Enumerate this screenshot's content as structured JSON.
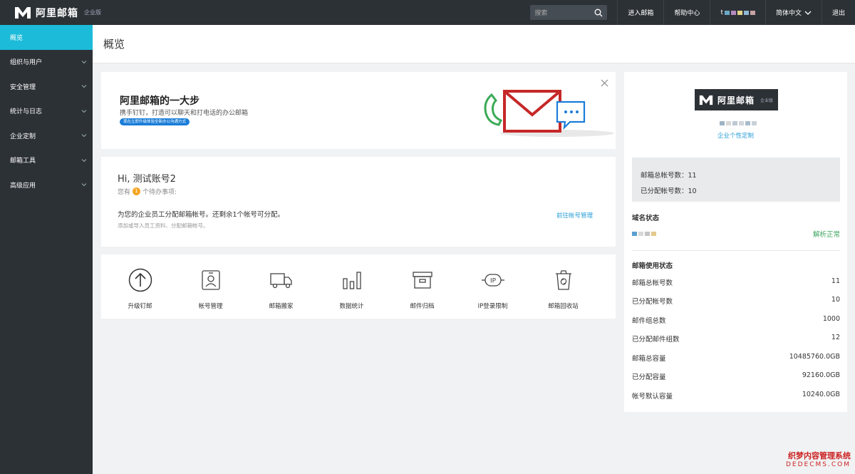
{
  "app": {
    "logo_text": "阿里邮箱",
    "logo_sub": "企业版"
  },
  "topbar": {
    "search_placeholder": "搜索",
    "enter_mailbox": "进入邮箱",
    "help_center": "帮助中心",
    "user_initial": "t",
    "language": "简体中文",
    "logout": "退出"
  },
  "sidebar": {
    "items": [
      {
        "label": "概览"
      },
      {
        "label": "组织与用户"
      },
      {
        "label": "安全管理"
      },
      {
        "label": "统计与日志"
      },
      {
        "label": "企业定制"
      },
      {
        "label": "邮箱工具"
      },
      {
        "label": "高级应用"
      }
    ]
  },
  "page": {
    "title": "概览"
  },
  "banner": {
    "title": "阿里邮箱的一大步",
    "subtitle": "携手钉钉，打造可以聊天和打电话的办公邮箱",
    "pill": "现在立即升级体验全新办公沟通方式"
  },
  "hello": {
    "greeting": "Hi, 测试账号2",
    "todo_prefix": "您有",
    "todo_count": "1",
    "todo_suffix": "个待办事项:",
    "task": "为您的企业员工分配邮箱帐号。还剩余1个帐号可分配。",
    "hint": "添加或导入员工资料、分配邮箱帐号。",
    "link": "前往帐号管理"
  },
  "tools": [
    {
      "label": "升级钉邮",
      "icon": "upgrade-icon"
    },
    {
      "label": "帐号管理",
      "icon": "account-icon"
    },
    {
      "label": "邮箱搬家",
      "icon": "truck-icon"
    },
    {
      "label": "数据统计",
      "icon": "bar-chart-icon"
    },
    {
      "label": "邮件归档",
      "icon": "archive-icon"
    },
    {
      "label": "IP登录限制",
      "icon": "ip-icon"
    },
    {
      "label": "邮箱回收站",
      "icon": "recycle-bin-icon"
    }
  ],
  "right_panel": {
    "customize_link": "企业个性定制",
    "stats": [
      {
        "text": "邮箱总帐号数：11"
      },
      {
        "text": "已分配帐号数：10"
      }
    ],
    "domain_section": "域名状态",
    "domain_status": "解析正常",
    "usage_section": "邮箱使用状态",
    "usage": [
      {
        "label": "邮箱总帐号数",
        "value": "11"
      },
      {
        "label": "已分配帐号数",
        "value": "10"
      },
      {
        "label": "邮件组总数",
        "value": "1000"
      },
      {
        "label": "已分配邮件组数",
        "value": "12"
      },
      {
        "label": "邮箱总容量",
        "value": "10485760.0GB"
      },
      {
        "label": "已分配容量",
        "value": "92160.0GB"
      },
      {
        "label": "帐号默认容量",
        "value": "10240.0GB"
      }
    ]
  },
  "watermark": {
    "cn": "织梦内容管理系统",
    "en": "DEDECMS.COM"
  },
  "colors": {
    "sidebar_bg": "#2c3136",
    "accent": "#1cbbd9",
    "link": "#2a9fd6",
    "success": "#3ba55c",
    "badge": "#f5a623"
  }
}
